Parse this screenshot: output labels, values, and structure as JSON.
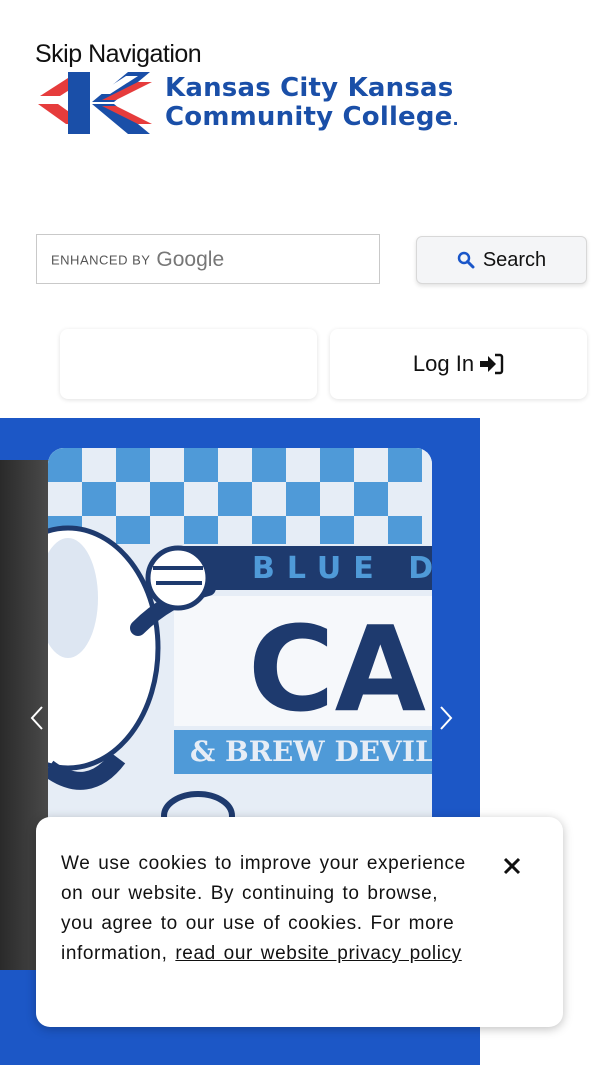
{
  "header": {
    "skip_nav": "Skip Navigation",
    "logo_line1": "Kansas City Kansas",
    "logo_line2": "Community College",
    "logo_suffix": "."
  },
  "search": {
    "enhanced_by": "ENHANCED BY",
    "google": "Google",
    "button_label": "Search"
  },
  "nav": {
    "login_label": "Log In"
  },
  "carousel": {
    "slide_text_top": "BLUE D",
    "slide_text_main": "CA",
    "slide_text_sub": "& BREW DEVIL C"
  },
  "cookie": {
    "message": "We use cookies to improve your experience on our website. By continuing to browse, you agree to our use of cookies. For more information,",
    "link_text": "read our website privacy policy"
  },
  "colors": {
    "brand_blue": "#1a4fa8",
    "carousel_blue": "#1c57c6",
    "logo_red": "#e63c3c"
  }
}
